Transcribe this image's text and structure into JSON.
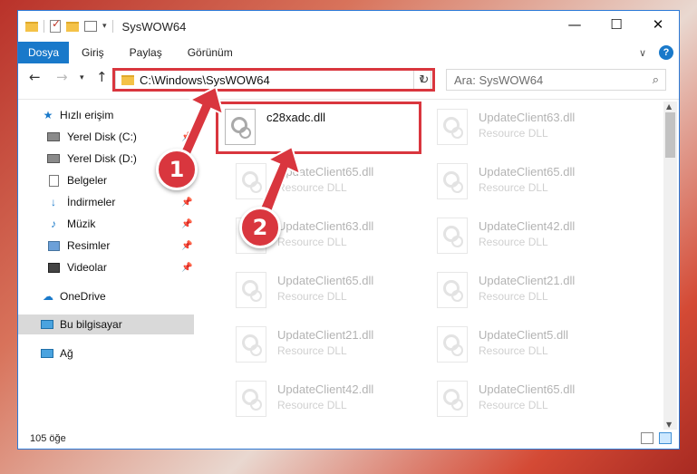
{
  "window": {
    "title": "SysWOW64",
    "controls": {
      "minimize": "—",
      "maximize": "☐",
      "close": "✕"
    }
  },
  "ribbon": {
    "tabs": [
      "Dosya",
      "Giriş",
      "Paylaş",
      "Görünüm"
    ],
    "help": "?"
  },
  "address": {
    "path": "C:\\Windows\\SysWOW64",
    "search_placeholder": "Ara: SysWOW64"
  },
  "sidebar": {
    "items": [
      {
        "label": "Hızlı erişim",
        "icon": "star-icon",
        "pinned": false
      },
      {
        "label": "Yerel Disk (C:)",
        "icon": "drive-icon",
        "pinned": true
      },
      {
        "label": "Yerel Disk (D:)",
        "icon": "drive-icon",
        "pinned": true
      },
      {
        "label": "Belgeler",
        "icon": "documents-icon",
        "pinned": true
      },
      {
        "label": "İndirmeler",
        "icon": "download-icon",
        "pinned": true
      },
      {
        "label": "Müzik",
        "icon": "music-icon",
        "pinned": true
      },
      {
        "label": "Resimler",
        "icon": "pictures-icon",
        "pinned": true
      },
      {
        "label": "Videolar",
        "icon": "videos-icon",
        "pinned": true
      },
      {
        "label": "OneDrive",
        "icon": "cloud-icon",
        "pinned": false
      },
      {
        "label": "Bu bilgisayar",
        "icon": "computer-icon",
        "pinned": false,
        "selected": true
      },
      {
        "label": "Ağ",
        "icon": "network-icon",
        "pinned": false
      }
    ]
  },
  "files": [
    {
      "name": "c28xadc.dll",
      "type": "",
      "highlight": true
    },
    {
      "name": "UpdateClient63.dll",
      "type": "Resource DLL"
    },
    {
      "name": "UpdateClient65.dll",
      "type": "Resource DLL"
    },
    {
      "name": "UpdateClient65.dll",
      "type": "Resource DLL"
    },
    {
      "name": "UpdateClient63.dll",
      "type": "Resource DLL"
    },
    {
      "name": "UpdateClient42.dll",
      "type": "Resource DLL"
    },
    {
      "name": "UpdateClient65.dll",
      "type": "Resource DLL"
    },
    {
      "name": "UpdateClient21.dll",
      "type": "Resource DLL"
    },
    {
      "name": "UpdateClient21.dll",
      "type": "Resource DLL"
    },
    {
      "name": "UpdateClient5.dll",
      "type": "Resource DLL"
    },
    {
      "name": "UpdateClient42.dll",
      "type": "Resource DLL"
    },
    {
      "name": "UpdateClient65.dll",
      "type": "Resource DLL"
    }
  ],
  "status": {
    "count": "105 öğe"
  },
  "annotations": {
    "step1": "1",
    "step2": "2",
    "color": "#d9363e"
  }
}
